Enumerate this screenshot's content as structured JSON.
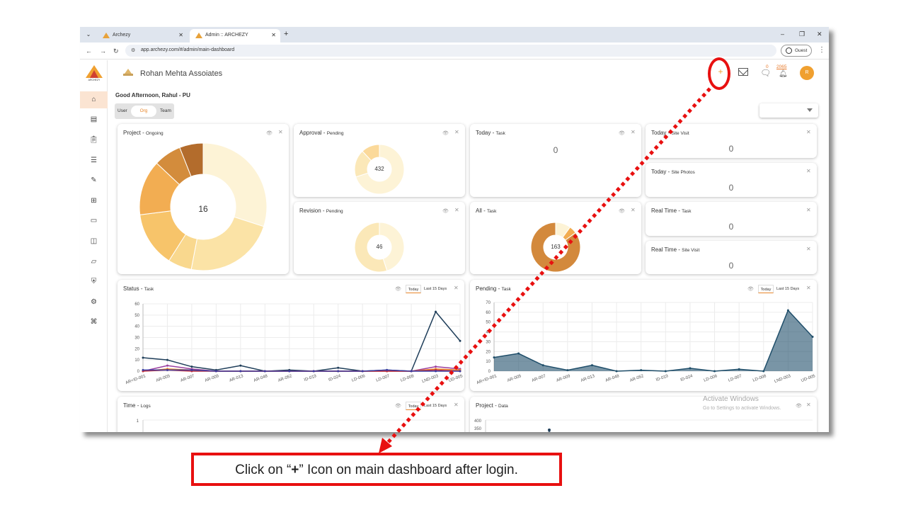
{
  "browser": {
    "tabs": [
      {
        "title": "Archezy",
        "active": false
      },
      {
        "title": "Admin :: ARCHEZY",
        "active": true
      }
    ],
    "url": "app.archezy.com/#/admin/main-dashboard",
    "profile_label": "Guest"
  },
  "app": {
    "brand": "ARCHEZY",
    "org_name": "Rohan Mehta Assoiates",
    "greeting": "Good Afternoon, Rahul - PU",
    "scope_tabs": [
      "User",
      "Org",
      "Team"
    ],
    "selected_scope": "Org",
    "avatar_initial": "R",
    "chat_count": "0",
    "notification_count": "2065",
    "sidebar_icons": [
      "home-icon",
      "building-icon",
      "clipboard-icon",
      "list-icon",
      "edit-icon",
      "contact-icon",
      "book-icon",
      "bag-icon",
      "folder-icon",
      "shield-icon",
      "settings-file-icon",
      "network-icon"
    ]
  },
  "cards": {
    "project": {
      "title": "Project",
      "subtitle": "Ongoing",
      "value": "16"
    },
    "approval": {
      "title": "Approval",
      "subtitle": "Pending",
      "value": "432"
    },
    "revision": {
      "title": "Revision",
      "subtitle": "Pending",
      "value": "46"
    },
    "today_task": {
      "title": "Today",
      "subtitle": "Task",
      "value": "0"
    },
    "all_task": {
      "title": "All",
      "subtitle": "Task",
      "value": "163"
    },
    "today_site_visit": {
      "title": "Today",
      "subtitle": "Site Visit",
      "value": "0"
    },
    "today_site_photos": {
      "title": "Today",
      "subtitle": "Site Photos",
      "value": "0"
    },
    "realtime_task": {
      "title": "Real Time",
      "subtitle": "Task",
      "value": "0"
    },
    "realtime_site_visit": {
      "title": "Real Time",
      "subtitle": "Site Visit",
      "value": "0"
    },
    "status_task": {
      "title": "Status",
      "subtitle": "Task"
    },
    "pending_task": {
      "title": "Pending",
      "subtitle": "Task"
    },
    "time_logs": {
      "title": "Time",
      "subtitle": "Logs"
    },
    "project_data": {
      "title": "Project",
      "subtitle": "Data"
    },
    "range_today": "Today",
    "range_last15": "Last 15 Days"
  },
  "chart_data": [
    {
      "type": "pie",
      "title": "Project - Ongoing",
      "values": [
        30,
        23,
        6,
        14,
        14,
        7,
        6
      ],
      "colors": [
        "#fdf3d6",
        "#fbe3a6",
        "#f9d88e",
        "#f7c46a",
        "#f2ad52",
        "#d38c3c",
        "#b36c2c"
      ]
    },
    {
      "type": "pie",
      "title": "Approval - Pending",
      "values": [
        70,
        18,
        12
      ],
      "colors": [
        "#fdf3d6",
        "#fbe8b8",
        "#fbd99a"
      ]
    },
    {
      "type": "pie",
      "title": "Revision - Pending",
      "values": [
        45,
        55
      ],
      "colors": [
        "#fdf3d6",
        "#fbe8b8"
      ]
    },
    {
      "type": "pie",
      "title": "All - Task",
      "values": [
        10,
        5,
        85
      ],
      "colors": [
        "#fdf3d6",
        "#f2ad52",
        "#d3893c"
      ]
    },
    {
      "type": "line",
      "title": "Status - Task",
      "categories": [
        "AR+ID-001",
        "AR-005",
        "AR-007",
        "AR-009",
        "AR-013",
        "AR-048",
        "AR-052",
        "ID-019",
        "ID-024",
        "LD-006",
        "LD-007",
        "LD-008",
        "LND-003",
        "UD-005"
      ],
      "ylim": [
        0,
        60
      ],
      "yticks": [
        0,
        10,
        20,
        30,
        40,
        50,
        60
      ],
      "series": [
        {
          "color": "#1f3e5a",
          "values": [
            12,
            10,
            4,
            1,
            5,
            0,
            1,
            0,
            3,
            0,
            1,
            0,
            53,
            27
          ]
        },
        {
          "color": "#9b3fa0",
          "values": [
            0,
            5,
            2,
            0,
            0,
            0,
            0,
            0,
            0,
            0,
            0,
            0,
            4,
            2
          ]
        },
        {
          "color": "#e8862a",
          "values": [
            0,
            2,
            1,
            0,
            0,
            0,
            0,
            0,
            0,
            0,
            0,
            0,
            2,
            1
          ]
        },
        {
          "color": "#c03040",
          "values": [
            0,
            1,
            0,
            0,
            0,
            0,
            0,
            0,
            0,
            0,
            0,
            0,
            1,
            0
          ]
        },
        {
          "color": "#3a3aa0",
          "values": [
            1,
            1,
            1,
            0,
            0,
            0,
            0,
            0,
            0,
            0,
            1,
            0,
            0,
            0
          ]
        }
      ]
    },
    {
      "type": "area",
      "title": "Pending - Task",
      "categories": [
        "AR+ID-001",
        "AR-005",
        "AR-007",
        "AR-009",
        "AR-013",
        "AR-048",
        "AR-052",
        "ID-019",
        "ID-024",
        "LD-006",
        "LD-007",
        "LD-008",
        "LND-003",
        "UD-005"
      ],
      "ylim": [
        0,
        70
      ],
      "yticks": [
        0,
        10,
        20,
        30,
        40,
        50,
        60,
        70
      ],
      "series": [
        {
          "color": "#1f4e6a",
          "values": [
            14,
            18,
            6,
            1,
            6,
            0,
            1,
            0,
            3,
            0,
            2,
            0,
            62,
            35
          ]
        }
      ]
    },
    {
      "type": "line",
      "title": "Time - Logs",
      "yticks": [
        1.0
      ]
    },
    {
      "type": "line",
      "title": "Project - Data",
      "yticks": [
        400,
        350
      ]
    }
  ],
  "watermark": {
    "line1": "Activate Windows",
    "line2": "Go to Settings to activate Windows."
  },
  "annotation": {
    "callout_before": "Click on “",
    "callout_symbol": "+",
    "callout_after": "” Icon on main dashboard after login.",
    "color": "#e81010"
  }
}
